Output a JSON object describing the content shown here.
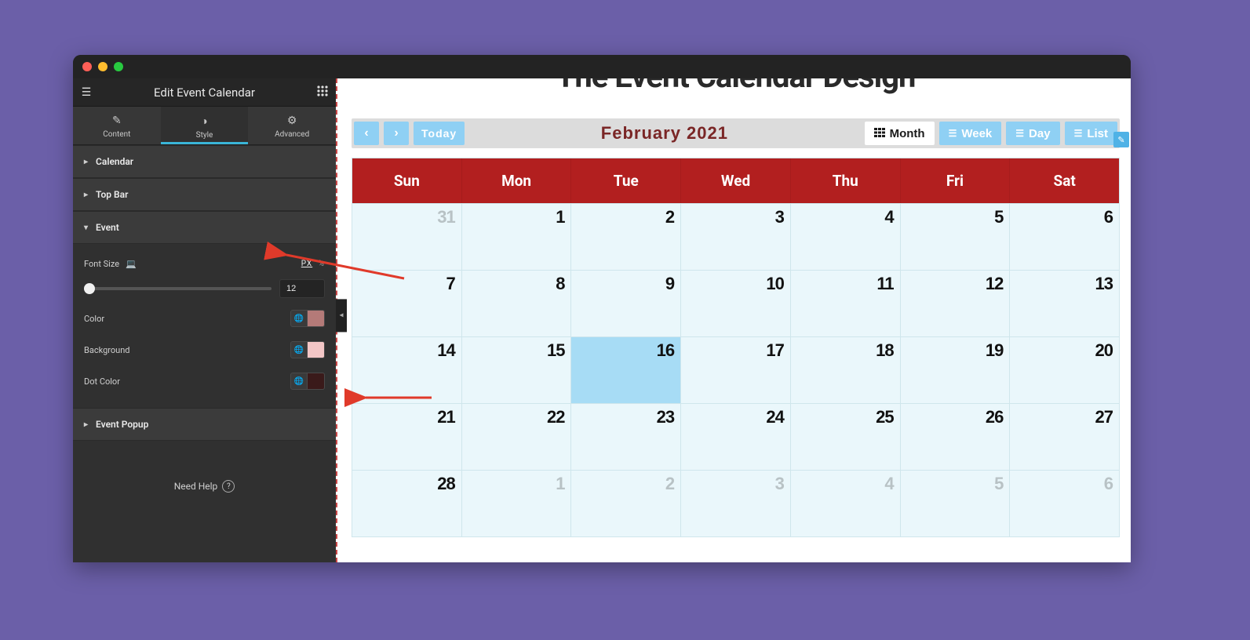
{
  "window": {
    "title": "Edit Event Calendar"
  },
  "sidebar": {
    "tabs": [
      {
        "label": "Content"
      },
      {
        "label": "Style"
      },
      {
        "label": "Advanced"
      }
    ],
    "active_tab_index": 1,
    "sections": {
      "calendar": {
        "title": "Calendar"
      },
      "top_bar": {
        "title": "Top Bar"
      },
      "event": {
        "title": "Event",
        "font_size_label": "Font Size",
        "unit_px": "PX",
        "unit_pct": "%",
        "font_size_value": "12",
        "color_label": "Color",
        "color_swatch": "#b47a78",
        "background_label": "Background",
        "background_swatch": "#f3c6c6",
        "dot_color_label": "Dot Color",
        "dot_color_swatch": "#3a1a1a"
      },
      "event_popup": {
        "title": "Event Popup"
      }
    },
    "help_label": "Need Help"
  },
  "preview": {
    "page_title": "The Event Calendar Design",
    "toolbar": {
      "today": "Today",
      "month_label": "February 2021",
      "views": {
        "month": "Month",
        "week": "Week",
        "day": "Day",
        "list": "List"
      }
    },
    "calendar": {
      "day_headers": [
        "Sun",
        "Mon",
        "Tue",
        "Wed",
        "Thu",
        "Fri",
        "Sat"
      ],
      "weeks": [
        [
          {
            "n": "31",
            "other": true
          },
          {
            "n": "1"
          },
          {
            "n": "2"
          },
          {
            "n": "3"
          },
          {
            "n": "4"
          },
          {
            "n": "5"
          },
          {
            "n": "6"
          }
        ],
        [
          {
            "n": "7"
          },
          {
            "n": "8"
          },
          {
            "n": "9"
          },
          {
            "n": "10"
          },
          {
            "n": "11"
          },
          {
            "n": "12"
          },
          {
            "n": "13"
          }
        ],
        [
          {
            "n": "14"
          },
          {
            "n": "15"
          },
          {
            "n": "16",
            "today": true
          },
          {
            "n": "17"
          },
          {
            "n": "18"
          },
          {
            "n": "19"
          },
          {
            "n": "20"
          }
        ],
        [
          {
            "n": "21"
          },
          {
            "n": "22"
          },
          {
            "n": "23"
          },
          {
            "n": "24"
          },
          {
            "n": "25"
          },
          {
            "n": "26"
          },
          {
            "n": "27"
          }
        ],
        [
          {
            "n": "28"
          },
          {
            "n": "1",
            "other": true
          },
          {
            "n": "2",
            "other": true
          },
          {
            "n": "3",
            "other": true
          },
          {
            "n": "4",
            "other": true
          },
          {
            "n": "5",
            "other": true
          },
          {
            "n": "6",
            "other": true
          }
        ]
      ]
    }
  }
}
